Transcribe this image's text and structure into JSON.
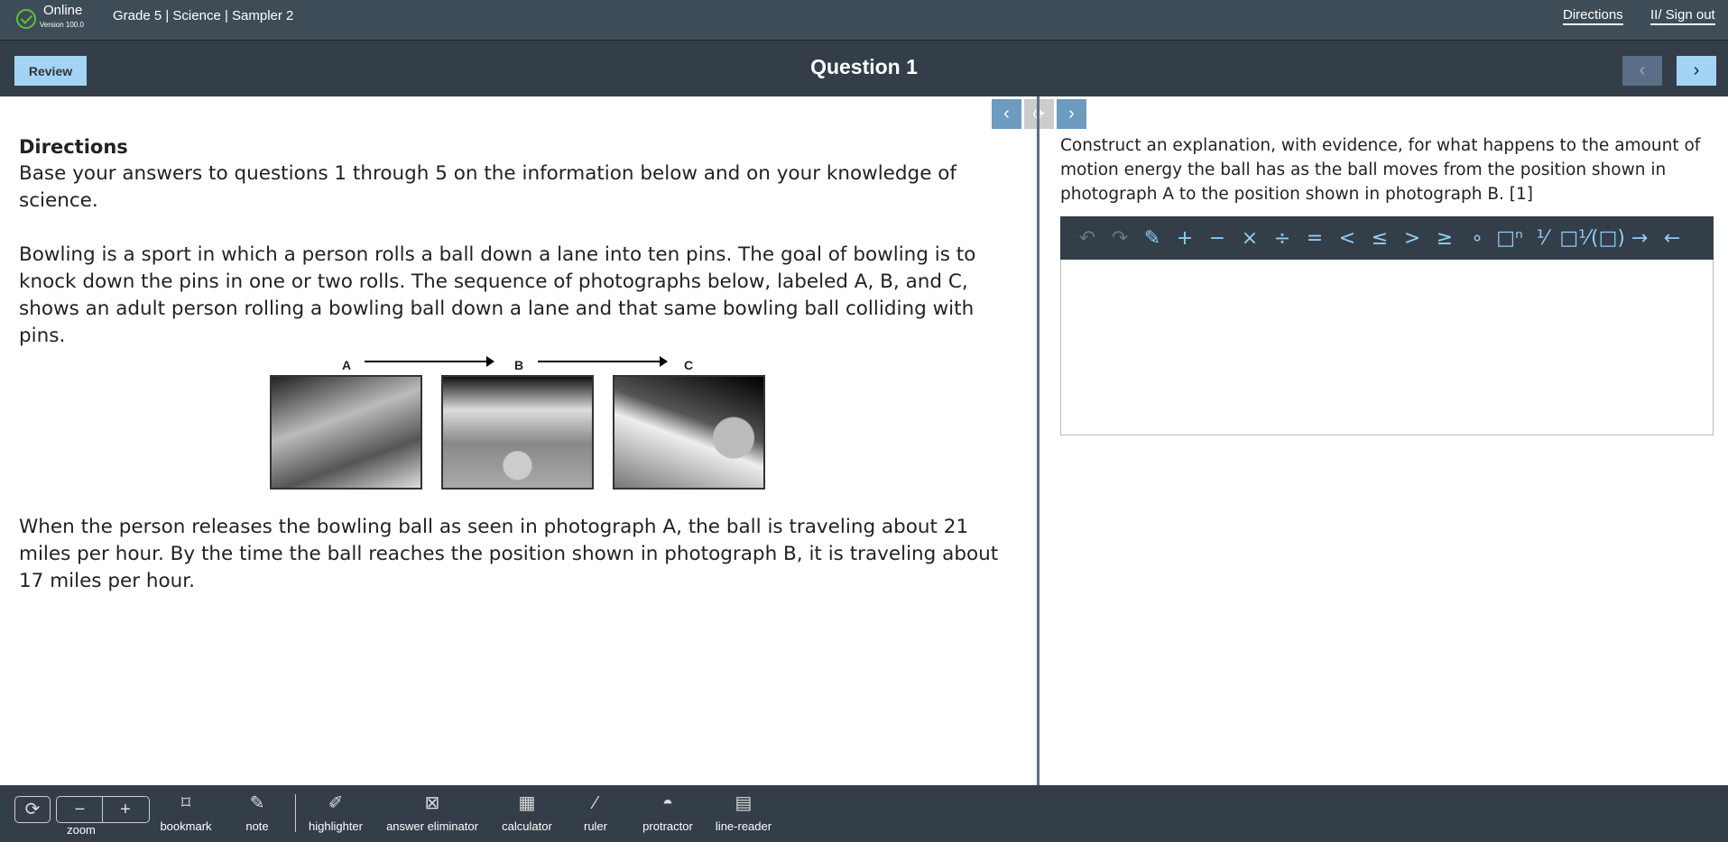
{
  "topbar": {
    "status": "Online",
    "version": "Version 100.0",
    "course": "Grade 5 | Science | Sampler 2",
    "directions": "Directions",
    "signout": "II/ Sign out"
  },
  "header": {
    "review": "Review",
    "title": "Question 1",
    "prev": "‹",
    "next": "›"
  },
  "passage": {
    "heading": "Directions",
    "p1": "Base your answers to questions 1 through 5 on the information below and on your knowledge of science.",
    "p2": "Bowling is a sport in which a person rolls a ball down a lane into ten pins. The goal of bowling is to knock down the pins in one or two rolls. The sequence of photographs below, labeled A, B, and C, shows an adult person rolling a bowling ball down a lane and that same bowling ball colliding with pins.",
    "labels": [
      "A",
      "B",
      "C"
    ],
    "p3": "When the person releases the bowling ball as seen in photograph A, the ball is traveling about 21 miles per hour. By the time the ball reaches the position shown in photograph B, it is traveling about 17 miles per hour."
  },
  "question": {
    "prompt": "Construct an explanation, with evidence, for what happens to the amount of motion energy the ball has as the ball moves from the position shown in photograph A to the position shown in photograph B. [1]"
  },
  "math_toolbar": [
    "↶",
    "↷",
    "✎",
    "+",
    "−",
    "×",
    "÷",
    "=",
    "<",
    "≤",
    ">",
    "≥",
    "∘",
    "□ⁿ",
    "⅟",
    "□⅟",
    "(□)",
    "→",
    "←"
  ],
  "tools": [
    "zoom",
    "bookmark",
    "note",
    "highlighter",
    "answer eliminator",
    "calculator",
    "ruler",
    "protractor",
    "line-reader"
  ],
  "colors": {
    "accent": "#a3d4f6",
    "bar": "#333e48",
    "top": "#3e4c57"
  }
}
